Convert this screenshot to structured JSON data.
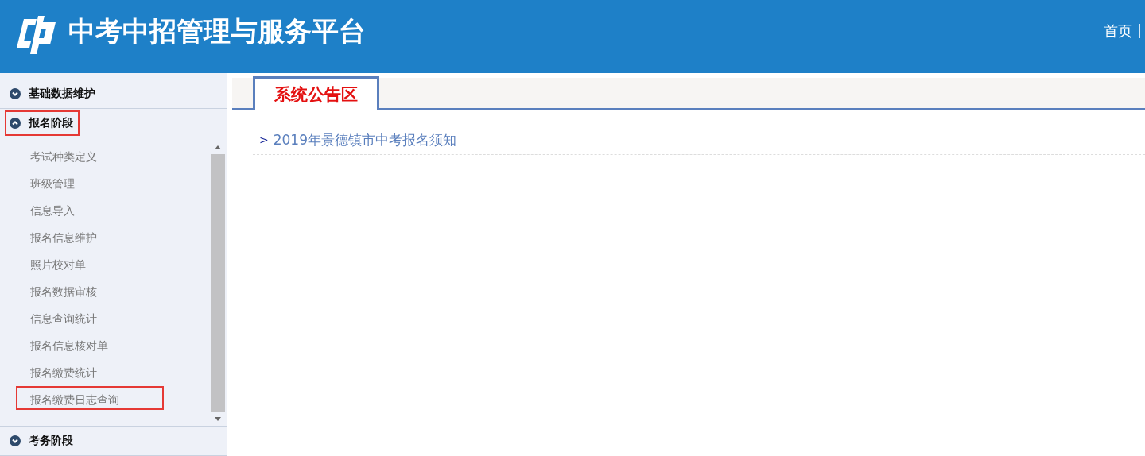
{
  "header": {
    "title": "中考中招管理与服务平台",
    "links": [
      "首页",
      "|"
    ]
  },
  "sidebar": {
    "sections": [
      {
        "label": "基础数据维护",
        "expanded": false,
        "highlighted": false
      },
      {
        "label": "报名阶段",
        "expanded": true,
        "highlighted": true,
        "items": [
          {
            "label": "考试种类定义",
            "highlighted": false
          },
          {
            "label": "班级管理",
            "highlighted": false
          },
          {
            "label": "信息导入",
            "highlighted": false
          },
          {
            "label": "报名信息维护",
            "highlighted": false
          },
          {
            "label": "照片校对单",
            "highlighted": false
          },
          {
            "label": "报名数据审核",
            "highlighted": false
          },
          {
            "label": "信息查询统计",
            "highlighted": false
          },
          {
            "label": "报名信息核对单",
            "highlighted": false
          },
          {
            "label": "报名缴费统计",
            "highlighted": false
          },
          {
            "label": "报名缴费日志查询",
            "highlighted": true
          }
        ]
      },
      {
        "label": "考务阶段",
        "expanded": false,
        "highlighted": false
      }
    ]
  },
  "tabs": [
    {
      "label": "系统公告区",
      "selected": true
    }
  ],
  "notices": [
    {
      "marker": ">",
      "title": "2019年景德镇市中考报名须知"
    }
  ]
}
